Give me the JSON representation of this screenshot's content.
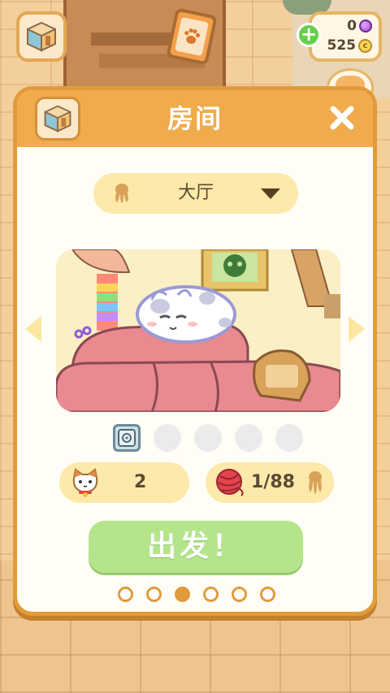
{
  "hud": {
    "gems": "0",
    "coins": "525",
    "coin_symbol": "c",
    "add_currency_symbol": "+"
  },
  "modal": {
    "title": "房间",
    "room_select": {
      "selected": "大厅"
    },
    "preview_slots": {
      "filled": 1,
      "total": 5
    },
    "stats": {
      "cats": "2",
      "yarn": "1/88"
    },
    "go_button": "出发！",
    "pagination": {
      "total": 6,
      "active_index": 2
    }
  },
  "colors": {
    "header": "#f0ab4c",
    "border": "#e39b3a",
    "pill": "#fde9a9",
    "go_button": "#b4e58b",
    "dot": "#e29a3c"
  },
  "icons": {
    "room": "isometric-room-icon",
    "paw_card": "paw-card-icon",
    "gem": "purple-gem-icon",
    "coin": "coin-icon",
    "plus": "plus-icon",
    "close": "close-icon",
    "paw": "paw-icon",
    "caret": "triangle-down-icon",
    "safe": "safe-icon",
    "cat": "cat-face-icon",
    "yarn": "yarn-ball-icon"
  }
}
